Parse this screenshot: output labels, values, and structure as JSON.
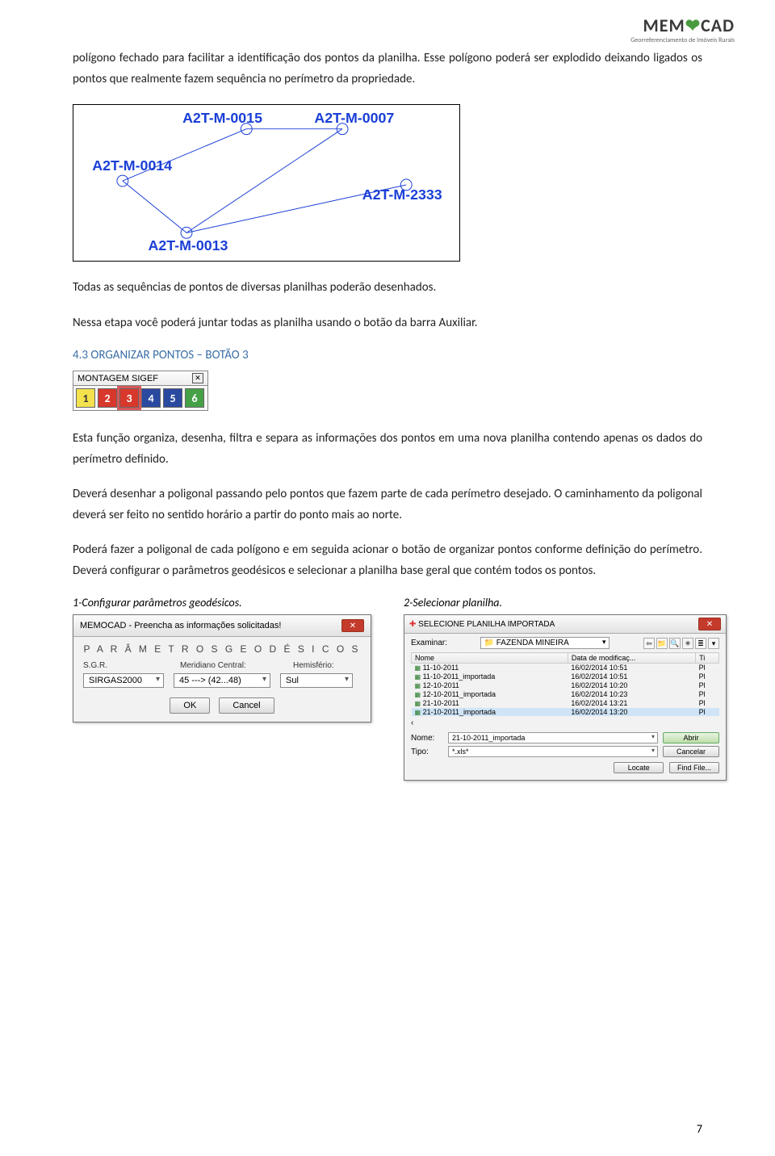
{
  "logo": {
    "brand_pre": "MEM",
    "brand_post": "CAD",
    "subtitle": "Georreferenciamento de Imóveis Rurais"
  },
  "para1": "polígono fechado para facilitar a identificação dos pontos da planilha. Esse polígono poderá ser explodido deixando ligados os pontos que realmente fazem sequência no perímetro da propriedade.",
  "diagram": {
    "labels": [
      "A2T-M-0015",
      "A2T-M-0007",
      "A2T-M-0014",
      "A2T-M-2333",
      "A2T-M-0013"
    ]
  },
  "para2": "Todas as sequências de pontos de diversas planilhas poderão desenhados.",
  "para3": "Nessa etapa você poderá juntar todas as planilha usando o botão da barra Auxiliar.",
  "section_heading": "4.3 ORGANIZAR PONTOS – BOTÃO 3",
  "toolbar": {
    "title": "MONTAGEM SIGEF",
    "buttons": [
      "1",
      "2",
      "3",
      "4",
      "5",
      "6"
    ]
  },
  "para4": "Esta função organiza, desenha, filtra e separa as informações dos pontos em uma nova planilha contendo apenas os dados do perímetro definido.",
  "para5": "Deverá desenhar a poligonal passando pelo pontos que fazem parte de cada perímetro desejado. O caminhamento da poligonal deverá ser feito no sentido horário a partir do ponto mais ao norte.",
  "para6": "Poderá fazer a poligonal de cada polígono e em seguida acionar o botão de organizar pontos conforme definição do perímetro. Deverá configurar o parâmetros geodésicos e selecionar a planilha base geral que contém todos os pontos.",
  "step1_label": "1-Configurar parâmetros geodésicos.",
  "step2_label": "2-Selecionar  planilha.",
  "dlg1": {
    "title": "MEMOCAD - Preencha as informações solicitadas!",
    "heading": "P A R Â M E T R O S   G E O D É S I C O S",
    "f1_label": "S.G.R.",
    "f1_value": "SIRGAS2000",
    "f2_label": "Meridiano Central:",
    "f2_value": "45 ---> (42...48)",
    "f3_label": "Hemisfério:",
    "f3_value": "Sul",
    "ok": "OK",
    "cancel": "Cancel"
  },
  "dlg2": {
    "title": "SELECIONE PLANILHA IMPORTADA",
    "examine_label": "Examinar:",
    "folder": "FAZENDA MINEIRA",
    "cols": [
      "Nome",
      "Data de modificaç...",
      "Ti"
    ],
    "rows": [
      {
        "name": "11-10-2011",
        "date": "16/02/2014 10:51",
        "t": "Pl"
      },
      {
        "name": "11-10-2011_importada",
        "date": "16/02/2014 10:51",
        "t": "Pl"
      },
      {
        "name": "12-10-2011",
        "date": "16/02/2014 10:20",
        "t": "Pl"
      },
      {
        "name": "12-10-2011_importada",
        "date": "16/02/2014 10:23",
        "t": "Pl"
      },
      {
        "name": "21-10-2011",
        "date": "16/02/2014 13:21",
        "t": "Pl"
      },
      {
        "name": "21-10-2011_importada",
        "date": "16/02/2014 13:20",
        "t": "Pl",
        "sel": true
      }
    ],
    "chevron": "‹",
    "name_label": "Nome:",
    "name_value": "21-10-2011_importada",
    "type_label": "Tipo:",
    "type_value": "*.xls*",
    "open": "Abrir",
    "cancel": "Cancelar",
    "locate": "Locate",
    "find": "Find File..."
  },
  "page_number": "7"
}
